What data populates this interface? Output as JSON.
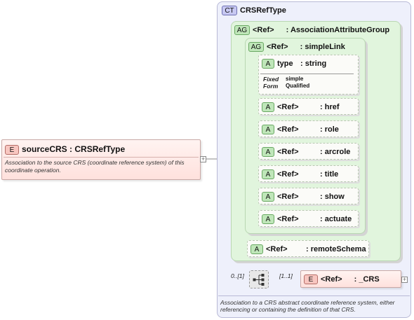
{
  "source_element": {
    "badge": "E",
    "name": "sourceCRS",
    "type": ": CRSRefType",
    "documentation": "Association to the source CRS (coordinate reference system) of this coordinate operation."
  },
  "complex_type": {
    "badge": "CT",
    "name": "CRSRefType",
    "documentation": "Association to a CRS abstract coordinate reference system, either referencing or containing the definition of that CRS."
  },
  "association_group": {
    "badge": "AG",
    "ref": "<Ref>",
    "type": ": AssociationAttributeGroup"
  },
  "simple_link_group": {
    "badge": "AG",
    "ref": "<Ref>",
    "type": ": simpleLink"
  },
  "type_attribute": {
    "badge": "A",
    "name": "type",
    "type": ": string",
    "fixed_label": "Fixed",
    "fixed_value": "simple",
    "form_label": "Form",
    "form_value": "Qualified"
  },
  "ref_attributes": [
    {
      "badge": "A",
      "ref": "<Ref>",
      "type": ": href"
    },
    {
      "badge": "A",
      "ref": "<Ref>",
      "type": ": role"
    },
    {
      "badge": "A",
      "ref": "<Ref>",
      "type": ": arcrole"
    },
    {
      "badge": "A",
      "ref": "<Ref>",
      "type": ": title"
    },
    {
      "badge": "A",
      "ref": "<Ref>",
      "type": ": show"
    },
    {
      "badge": "A",
      "ref": "<Ref>",
      "type": ": actuate"
    }
  ],
  "remote_schema": {
    "badge": "A",
    "ref": "<Ref>",
    "type": ": remoteSchema"
  },
  "sequence": {
    "outer_cardinality": "0..[1]",
    "inner_cardinality": "[1..1]"
  },
  "abstract_crs": {
    "badge": "E",
    "ref": "<Ref>",
    "type": ": _CRS"
  },
  "icons": {
    "expand": "+",
    "sequence": "sequence-compositor-icon"
  }
}
